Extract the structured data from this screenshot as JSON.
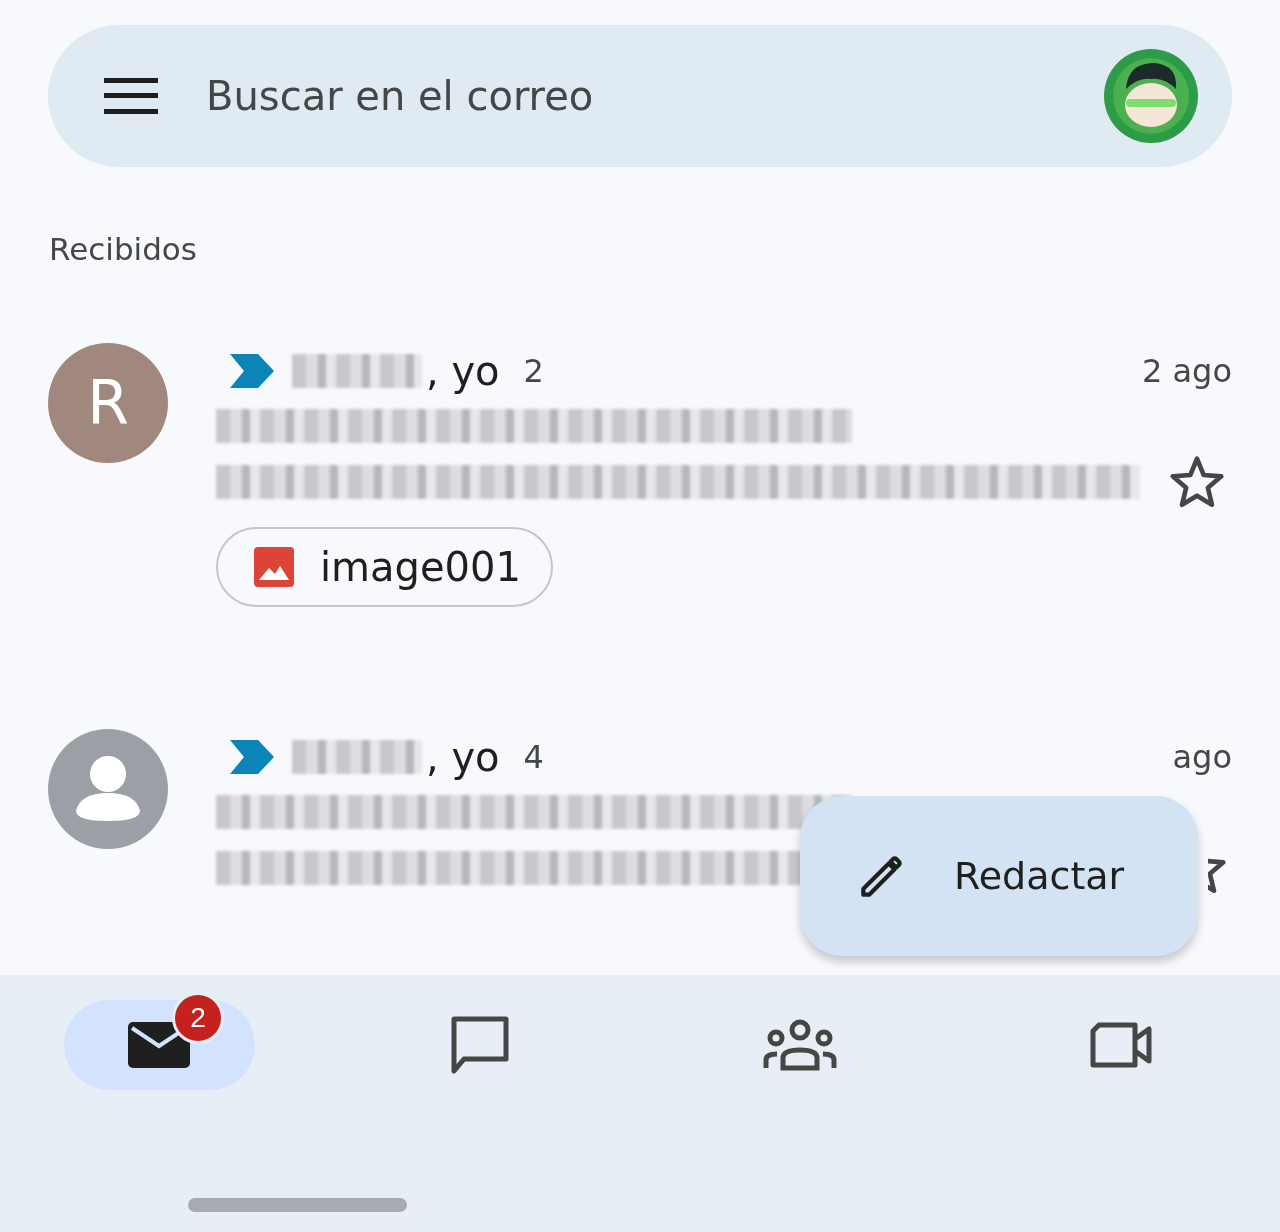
{
  "search": {
    "placeholder": "Buscar en el correo"
  },
  "section_title": "Recibidos",
  "emails": [
    {
      "avatar": {
        "kind": "letter",
        "letter": "R",
        "color": "#a1887f"
      },
      "important": true,
      "sender_suffix": ", yo",
      "count": "2",
      "time": "2 ago",
      "starred": false,
      "attachment": "image001"
    },
    {
      "avatar": {
        "kind": "person",
        "color": "#9aa0a6"
      },
      "important": true,
      "sender_suffix": ", yo",
      "count": "4",
      "time": "ago",
      "starred": false
    }
  ],
  "compose_button": "Redactar",
  "nav": [
    {
      "kind": "mail",
      "selected": true,
      "badge": "2"
    },
    {
      "kind": "chat",
      "selected": false
    },
    {
      "kind": "spaces",
      "selected": false
    },
    {
      "kind": "meet",
      "selected": false
    }
  ]
}
